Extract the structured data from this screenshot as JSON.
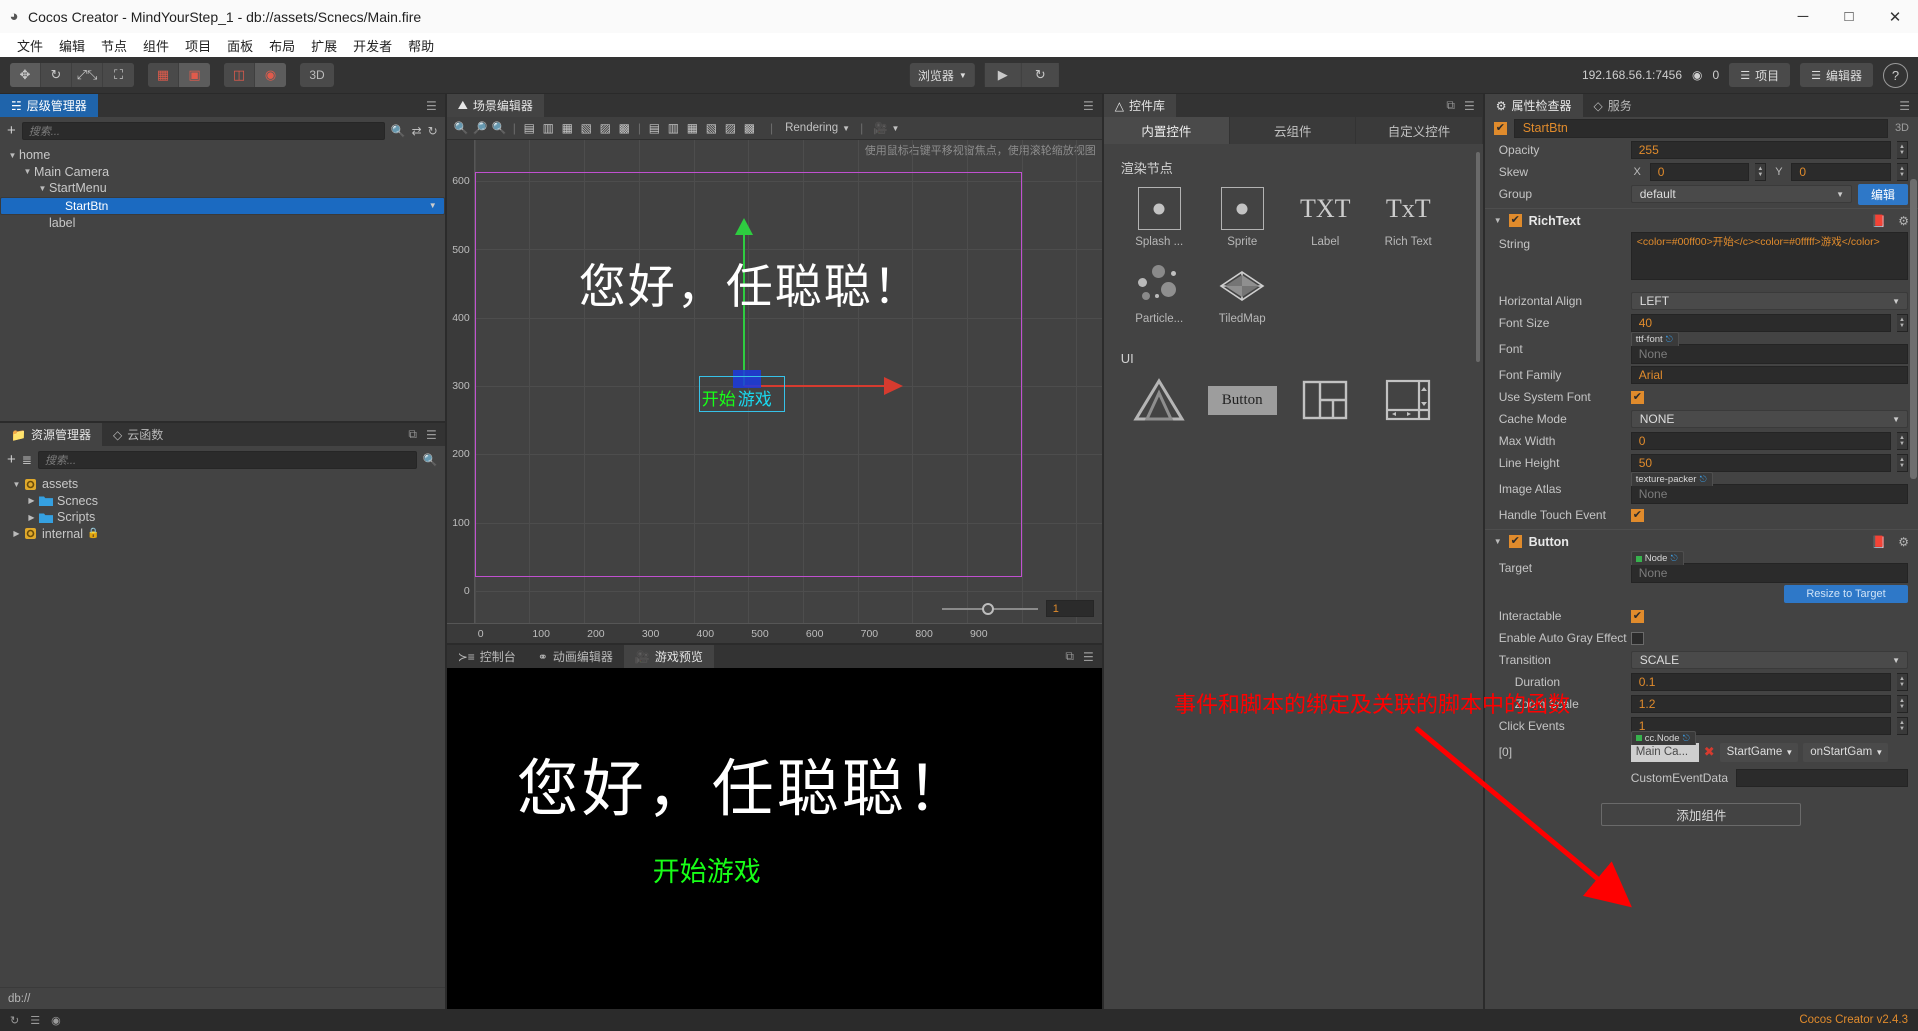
{
  "window": {
    "title": "Cocos Creator - MindYourStep_1 - db://assets/Scnecs/Main.fire",
    "app_icon": "cocos-logo-icon",
    "minimize": "─",
    "maximize": "□",
    "close": "✕"
  },
  "menubar": [
    "文件",
    "编辑",
    "节点",
    "组件",
    "项目",
    "面板",
    "布局",
    "扩展",
    "开发者",
    "帮助"
  ],
  "toolbar": {
    "transform_tools": [
      "move-tool-icon",
      "rotate-tool-icon",
      "scale-tool-icon",
      "rect-tool-icon"
    ],
    "pivot_tools": [
      "pivot-icon",
      "coordinate-icon"
    ],
    "align_tools": [
      "anchor-icon",
      "global-icon"
    ],
    "mode_3d": "3D",
    "browser_select": "浏览器",
    "play_label": "▶",
    "refresh_label": "↻",
    "ip_address": "192.168.56.1:7456",
    "wifi_icon": "wifi-icon",
    "device_count": "0",
    "project_button": "项目",
    "editor_button": "编辑器",
    "help_button": "?"
  },
  "hierarchy": {
    "tab_label": "层级管理器",
    "tab_icon": "hierarchy-icon",
    "search_placeholder": "搜索...",
    "add_icon": "+",
    "search_icon": "search-icon",
    "collapse_icon": "collapse-icon",
    "refresh_icon": "refresh-icon",
    "nodes": [
      {
        "label": "home",
        "depth": 0,
        "expanded": true,
        "selected": false
      },
      {
        "label": "Main Camera",
        "depth": 1,
        "expanded": true,
        "selected": false
      },
      {
        "label": "StartMenu",
        "depth": 2,
        "expanded": true,
        "selected": false
      },
      {
        "label": "StartBtn",
        "depth": 3,
        "expanded": false,
        "selected": true
      },
      {
        "label": "label",
        "depth": 2,
        "expanded": false,
        "selected": false
      }
    ]
  },
  "assets": {
    "tabs": [
      {
        "label": "资源管理器",
        "icon": "folder-icon",
        "active": true
      },
      {
        "label": "云函数",
        "icon": "cloud-icon",
        "active": false
      }
    ],
    "search_placeholder": "搜索...",
    "add_icon": "+",
    "sort_icon": "sort-icon",
    "search_icon": "search-icon",
    "tree": [
      {
        "label": "assets",
        "depth": 0,
        "expanded": true,
        "icon": "db-icon",
        "locked": false
      },
      {
        "label": "Scnecs",
        "depth": 1,
        "expanded": false,
        "icon": "folder-icon",
        "locked": false
      },
      {
        "label": "Scripts",
        "depth": 1,
        "expanded": false,
        "icon": "folder-icon",
        "locked": false
      },
      {
        "label": "internal",
        "depth": 0,
        "expanded": false,
        "icon": "db-icon",
        "locked": true
      }
    ],
    "path_bar": "db://"
  },
  "scene_editor": {
    "tab_label": "场景编辑器",
    "tab_icon": "scene-icon",
    "menu_icon": "hamburger-icon",
    "tools": [
      "zoom-in-icon",
      "zoom-out-icon",
      "zoom-reset-icon"
    ],
    "align_tools": [
      "align-left-icon",
      "align-center-h-icon",
      "align-right-icon",
      "distribute-h-left-icon",
      "distribute-h-center-icon",
      "distribute-h-right-icon",
      "align-top-icon",
      "align-middle-icon",
      "align-bottom-icon",
      "distribute-v-top-icon",
      "distribute-v-middle-icon",
      "distribute-v-bottom-icon"
    ],
    "rendering_label": "Rendering",
    "camera_icon": "camera-icon",
    "hint": "使用鼠标右键平移视窗焦点，使用滚轮缩放视图",
    "ruler_x": [
      "0",
      "100",
      "200",
      "300",
      "400",
      "500",
      "600",
      "700",
      "800",
      "900"
    ],
    "ruler_y": [
      "0",
      "100",
      "200",
      "300",
      "400",
      "500",
      "600"
    ],
    "scene_text": "您好，任聪聪！",
    "button_text_green": "开始",
    "button_text_cyan": "游戏",
    "zoom_value": "1"
  },
  "component_library": {
    "tab_label": "控件库",
    "tab_icon": "triangle-icon",
    "popout_icon": "popout-icon",
    "menu_icon": "hamburger-icon",
    "tabs": [
      {
        "label": "内置控件",
        "active": true
      },
      {
        "label": "云组件",
        "active": false
      },
      {
        "label": "自定义控件",
        "active": false
      }
    ],
    "sections": [
      {
        "title": "渲染节点",
        "items": [
          {
            "label": "Splash ...",
            "icon": "splash-icon"
          },
          {
            "label": "Sprite",
            "icon": "sprite-icon"
          },
          {
            "label": "Label",
            "icon": "txt-icon"
          },
          {
            "label": "Rich Text",
            "icon": "rich-text-icon"
          },
          {
            "label": "Particle...",
            "icon": "particle-icon"
          },
          {
            "label": "TiledMap",
            "icon": "tiledmap-icon"
          }
        ]
      },
      {
        "title": "UI",
        "items": [
          {
            "label": "",
            "icon": "canvas-icon"
          },
          {
            "label": "",
            "icon": "button-icon"
          },
          {
            "label": "",
            "icon": "layout-icon"
          },
          {
            "label": "",
            "icon": "scrollview-icon"
          }
        ]
      }
    ],
    "button_icon_label": "Button",
    "txt_label": "TXT",
    "richtxt_label": "TxT"
  },
  "bottom_panel": {
    "tabs": [
      {
        "label": "控制台",
        "icon": "console-icon",
        "active": false
      },
      {
        "label": "动画编辑器",
        "icon": "anim-icon",
        "active": false
      },
      {
        "label": "游戏预览",
        "icon": "preview-icon",
        "active": true
      }
    ],
    "popout_icon": "popout-icon",
    "menu_icon": "hamburger-icon",
    "game_text_main": "您好，任聪聪！",
    "game_text_button": "开始游戏"
  },
  "inspector": {
    "tabs": [
      {
        "label": "属性检查器",
        "icon": "gear-icon",
        "active": true
      },
      {
        "label": "服务",
        "icon": "cloud-icon",
        "active": false
      }
    ],
    "menu_icon": "hamburger-icon",
    "node_name": "StartBtn",
    "node_enabled": true,
    "badge_3d": "3D",
    "node_props": [
      {
        "label": "Opacity",
        "type": "number",
        "value": "255"
      },
      {
        "label": "Skew",
        "type": "xy",
        "x_label": "X",
        "x": "0",
        "y_label": "Y",
        "y": "0"
      },
      {
        "label": "Group",
        "type": "select",
        "value": "default",
        "button": "编辑"
      }
    ],
    "components": [
      {
        "name": "RichText",
        "enabled": true,
        "help_icon": "book-icon",
        "gear_icon": "gear-icon",
        "props": [
          {
            "label": "String",
            "type": "textarea",
            "value": "<color=#00ff00>开始</c><color=#0fffff>游戏</color>"
          },
          {
            "label": "Horizontal Align",
            "type": "select",
            "value": "LEFT"
          },
          {
            "label": "Font Size",
            "type": "number",
            "value": "40"
          },
          {
            "label": "Font",
            "type": "asset",
            "tag": "ttf-font",
            "value": "None"
          },
          {
            "label": "Font Family",
            "type": "text",
            "value": "Arial"
          },
          {
            "label": "Use System Font",
            "type": "checkbox",
            "value": true
          },
          {
            "label": "Cache Mode",
            "type": "select",
            "value": "NONE"
          },
          {
            "label": "Max Width",
            "type": "number",
            "value": "0"
          },
          {
            "label": "Line Height",
            "type": "number",
            "value": "50"
          },
          {
            "label": "Image Atlas",
            "type": "asset",
            "tag": "texture-packer",
            "value": "None"
          },
          {
            "label": "Handle Touch Event",
            "type": "checkbox",
            "value": true
          }
        ]
      },
      {
        "name": "Button",
        "enabled": true,
        "help_icon": "book-icon",
        "gear_icon": "gear-icon",
        "props": [
          {
            "label": "Target",
            "type": "asset",
            "tag": "Node",
            "value": "None"
          },
          {
            "label": "",
            "type": "button",
            "value": "Resize to Target"
          },
          {
            "label": "Interactable",
            "type": "checkbox",
            "value": true
          },
          {
            "label": "Enable Auto Gray Effect",
            "type": "checkbox",
            "value": false
          },
          {
            "label": "Transition",
            "type": "select",
            "value": "SCALE"
          },
          {
            "label": "Duration",
            "type": "number",
            "value": "0.1",
            "indent": true
          },
          {
            "label": "Zoom Scale",
            "type": "number",
            "value": "1.2",
            "indent": true
          },
          {
            "label": "Click Events",
            "type": "number",
            "value": "1"
          }
        ],
        "click_events": {
          "index_label": "[0]",
          "node_tag": "cc.Node",
          "node_value": "Main Ca...",
          "remove_icon": "✖",
          "component_select": "StartGame",
          "handler_select": "onStartGam",
          "custom_event_label": "CustomEventData",
          "custom_event_value": ""
        }
      }
    ],
    "add_component_button": "添加组件"
  },
  "annotations": [
    {
      "text": "事件和脚本的绑定及关联的脚本中的函数",
      "color": "#ff0000"
    }
  ],
  "status_bar": {
    "icons": [
      "refresh-icon",
      "list-icon",
      "bug-icon"
    ],
    "version": "Cocos Creator v2.4.3"
  }
}
